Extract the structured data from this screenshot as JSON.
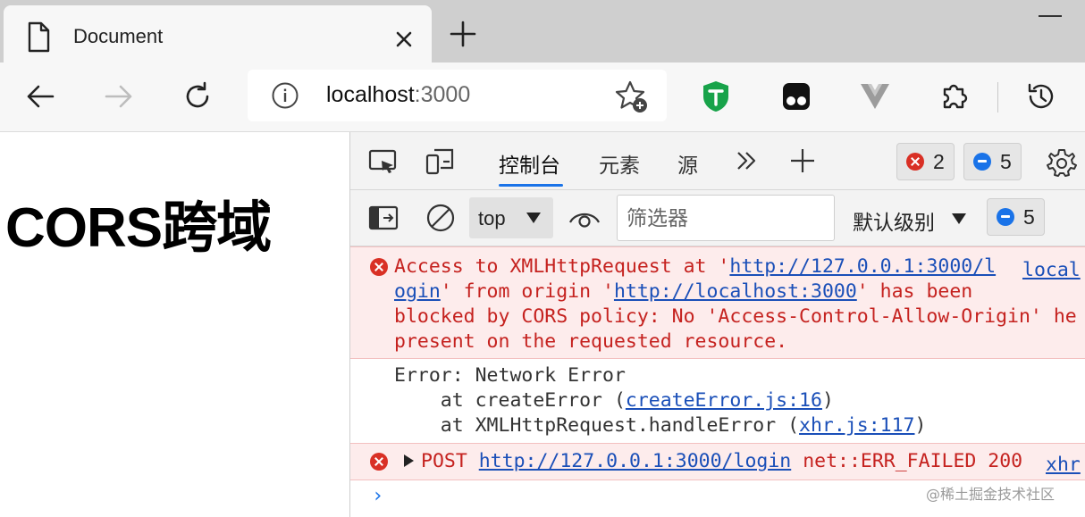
{
  "tab": {
    "title": "Document",
    "icon": "document-icon"
  },
  "address_bar": {
    "host": "localhost",
    "port": ":3000"
  },
  "page": {
    "heading": "CORS跨域"
  },
  "devtools": {
    "tabs": [
      "控制台",
      "元素",
      "源"
    ],
    "error_count": "2",
    "message_count": "5",
    "context": "top",
    "filter_placeholder": "筛选器",
    "levels": "默认级别",
    "issues_count": "5"
  },
  "console": {
    "cors_error": {
      "line1_pre": "Access to XMLHttpRequest at '",
      "line1_link": "http://127.0.0.1:3000/l",
      "line2_link": "ogin",
      "line2_mid": "' from origin '",
      "line2_link2": "http://localhost:3000",
      "line2_post": "' has been",
      "line3": "blocked by CORS policy: No 'Access-Control-Allow-Origin' he",
      "line4": "present on the requested resource.",
      "source": "local"
    },
    "stack": {
      "line1": "Error: Network Error",
      "line2_pre": "    at createError (",
      "line2_link": "createError.js:16",
      "line2_post": ")",
      "line3_pre": "    at XMLHttpRequest.handleError (",
      "line3_link": "xhr.js:117",
      "line3_post": ")"
    },
    "post_error": {
      "method": "POST",
      "url": "http://127.0.0.1:3000/login",
      "status": "net::ERR_FAILED 200",
      "source": "xhr"
    },
    "prompt": "›"
  },
  "watermark": "@稀土掘金技术社区",
  "colors": {
    "error": "#c5221f",
    "link": "#1a4fb8",
    "accent": "#1a73e8"
  }
}
